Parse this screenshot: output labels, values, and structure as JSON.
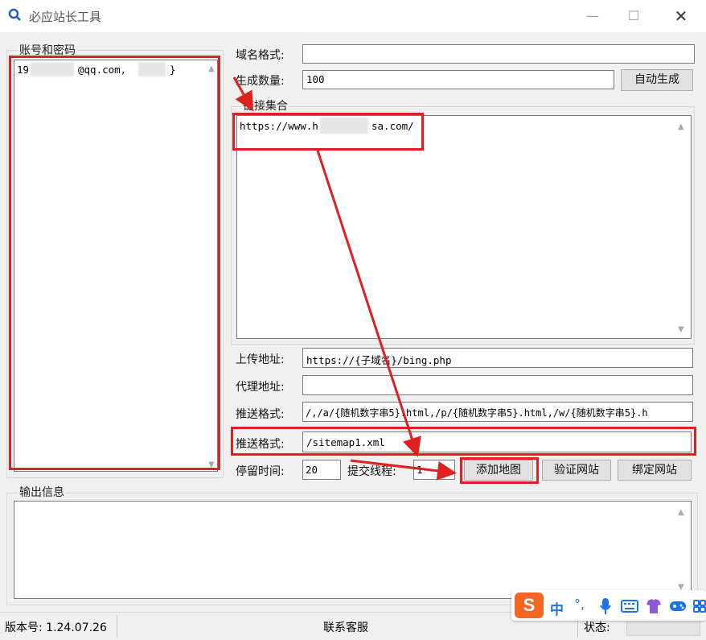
{
  "window": {
    "title": "必应站长工具"
  },
  "accounts": {
    "label": "账号和密码",
    "entry_prefix": "19",
    "entry_middle": "@qq.com,",
    "entry_suffix": "}"
  },
  "form": {
    "domain_format_label": "域名格式:",
    "domain_format_value": "",
    "gen_count_label": "生成数量:",
    "gen_count_value": "100",
    "auto_gen_button": "自动生成",
    "links_label": "链接集合",
    "links_prefix": "https://www.h",
    "links_suffix": "sa.com/",
    "upload_label": "上传地址:",
    "upload_value": "https://{子域名}/bing.php",
    "proxy_label": "代理地址:",
    "proxy_value": "",
    "push_format_label": "推送格式:",
    "push_format_value": "/,/a/{随机数字串5}.html,/p/{随机数字串5}.html,/w/{随机数字串5}.h",
    "push_format2_label": "推送格式:",
    "push_format2_value": "/sitemap1.xml",
    "pause_label": "停留时间:",
    "pause_value": "20",
    "threads_label": "提交线程:",
    "threads_value": "1",
    "add_map_button": "添加地图",
    "verify_button": "验证网站",
    "bind_button": "绑定网站"
  },
  "output": {
    "label": "输出信息"
  },
  "status": {
    "version": "版本号: 1.24.07.26",
    "contact": "联系客服",
    "state_label": "状态:"
  },
  "ime": {
    "logo": "S",
    "lang": "中",
    "punct": "°,",
    "items": [
      "mic-icon",
      "keyboard-icon",
      "skin-icon",
      "game-icon",
      "grid-icon"
    ]
  },
  "colors": {
    "annotation": "#e02020",
    "ime_orange": "#f26522"
  }
}
